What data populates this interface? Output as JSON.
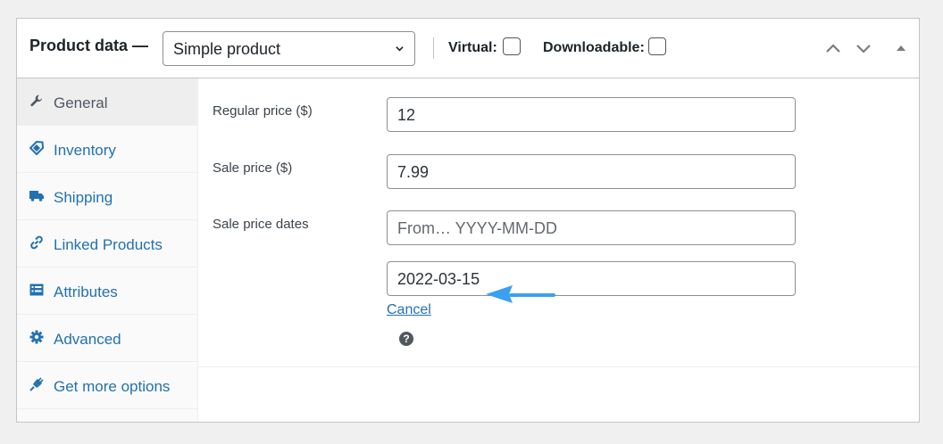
{
  "header": {
    "title": "Product data —",
    "product_type": "Simple product",
    "virtual_label": "Virtual:",
    "downloadable_label": "Downloadable:",
    "virtual_checked": false,
    "downloadable_checked": false
  },
  "sidebar": {
    "items": [
      {
        "label": "General",
        "icon": "wrench-icon",
        "active": true
      },
      {
        "label": "Inventory",
        "icon": "tag-icon",
        "active": false
      },
      {
        "label": "Shipping",
        "icon": "truck-icon",
        "active": false
      },
      {
        "label": "Linked Products",
        "icon": "link-icon",
        "active": false
      },
      {
        "label": "Attributes",
        "icon": "list-icon",
        "active": false
      },
      {
        "label": "Advanced",
        "icon": "gear-icon",
        "active": false
      },
      {
        "label": "Get more options",
        "icon": "plugin-icon",
        "active": false
      }
    ]
  },
  "fields": {
    "regular_price": {
      "label": "Regular price ($)",
      "value": "12"
    },
    "sale_price": {
      "label": "Sale price ($)",
      "value": "7.99"
    },
    "sale_dates": {
      "label": "Sale price dates",
      "from_placeholder": "From… YYYY-MM-DD",
      "to_value": "2022-03-15"
    },
    "cancel_label": "Cancel",
    "help_icon": "?"
  },
  "colors": {
    "link": "#2271b1",
    "annotation_arrow": "#3aa0f0"
  }
}
